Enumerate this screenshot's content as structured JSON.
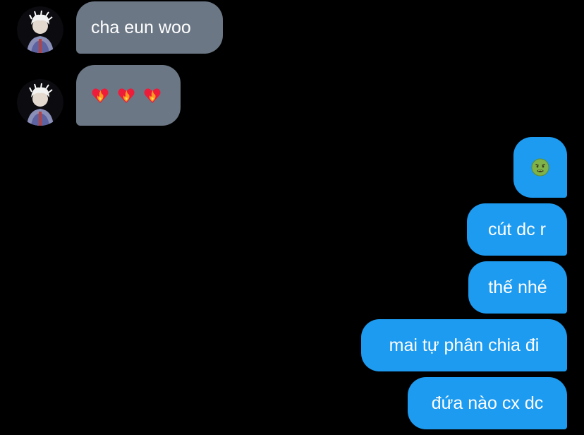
{
  "conversation": {
    "incoming": [
      {
        "text": "cha eun woo"
      },
      {
        "emojis": [
          "heart-on-fire-emoji",
          "heart-on-fire-emoji",
          "heart-on-fire-emoji"
        ]
      }
    ],
    "outgoing": [
      {
        "emoji": "nauseated-face-emoji"
      },
      {
        "text": "cút dc r"
      },
      {
        "text": "thế nhé"
      },
      {
        "text": "mai tự phân chia đi"
      },
      {
        "text": "đứa nào cx dc"
      }
    ]
  },
  "colors": {
    "background": "#000000",
    "incoming_bubble": "#6b7785",
    "outgoing_bubble": "#1d9bf0",
    "text": "#ffffff"
  }
}
